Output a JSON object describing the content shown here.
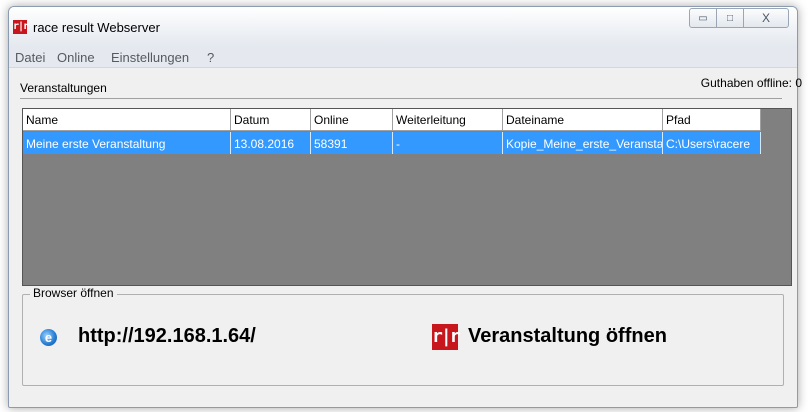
{
  "window": {
    "title": "race result Webserver",
    "logo_text": "r|r",
    "buttons": {
      "minimize": "▭",
      "maximize": "□",
      "close": "X"
    }
  },
  "menu": [
    "Datei",
    "Online",
    "Einstellungen",
    "?"
  ],
  "events": {
    "label": "Veranstaltungen",
    "credit": "Guthaben offline: 0",
    "columns": [
      "Name",
      "Datum",
      "Online",
      "Weiterleitung",
      "Dateiname",
      "Pfad"
    ],
    "rows": [
      [
        "Meine erste Veranstaltung",
        "13.08.2016",
        "58391",
        "-",
        "Kopie_Meine_erste_Veranstaltung",
        "C:\\Users\\racere"
      ]
    ]
  },
  "browser": {
    "legend": "Browser öffnen",
    "ie_icon": "e",
    "url": "http://192.168.1.64/",
    "rr_logo": "r|r",
    "open_event": "Veranstaltung öffnen"
  }
}
